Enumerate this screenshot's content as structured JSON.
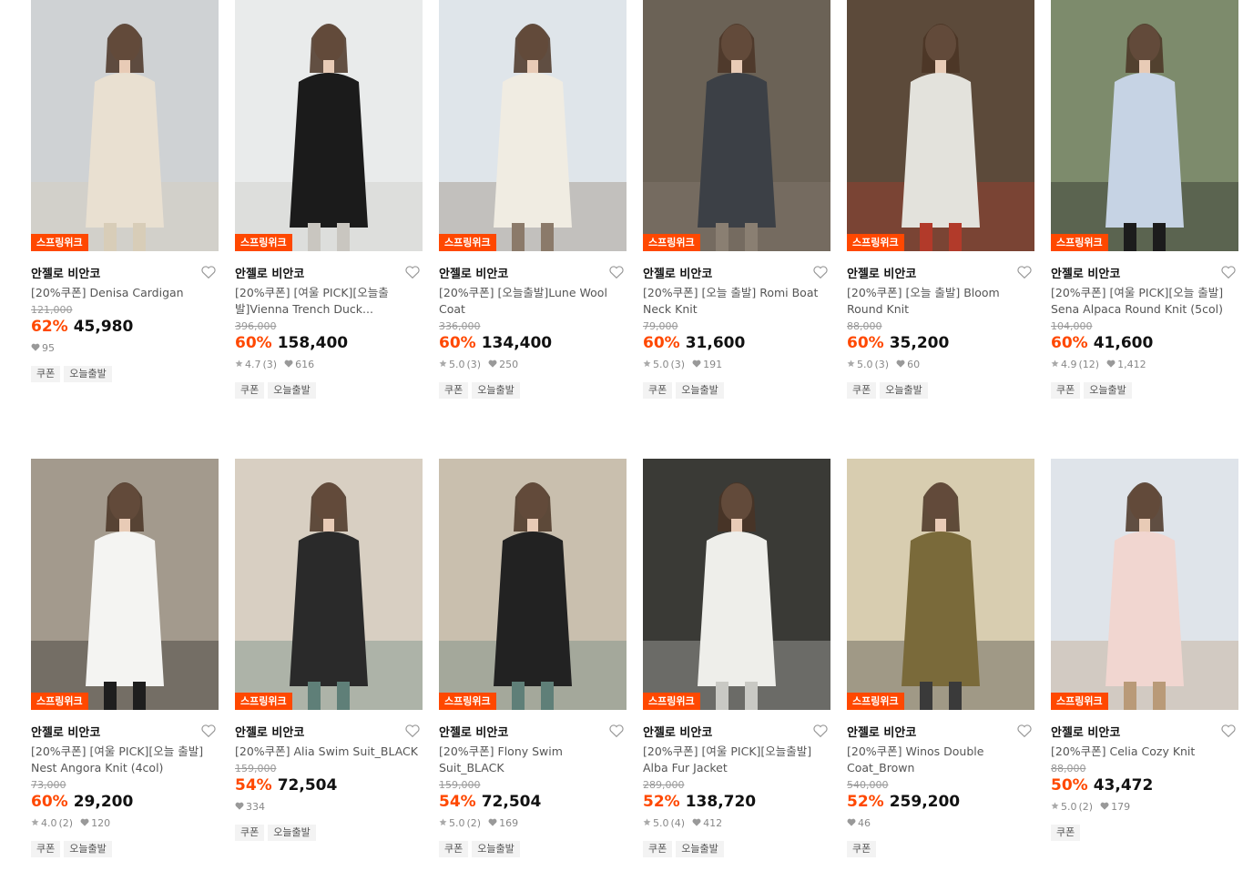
{
  "badge_label": "스프링위크",
  "products": [
    {
      "brand": "안젤로 비안코",
      "name": "[20%쿠폰] Denisa Cardigan",
      "original_price": "121,000",
      "discount": "62%",
      "price": "45,980",
      "rating": "",
      "reviews": "",
      "likes": "95",
      "tags": [
        "쿠폰",
        "오늘출발"
      ],
      "palette": {
        "bg": "#cfd2d4",
        "main": "#e9e0d1",
        "accent": "#d8cdb8"
      }
    },
    {
      "brand": "안젤로 비안코",
      "name": "[20%쿠폰] [여울 PICK][오늘출발]Vienna Trench Duck...",
      "original_price": "396,000",
      "discount": "60%",
      "price": "158,400",
      "rating": "4.7",
      "reviews": "(3)",
      "likes": "616",
      "tags": [
        "쿠폰",
        "오늘출발"
      ],
      "palette": {
        "bg": "#e9ebeb",
        "main": "#1b1b1b",
        "accent": "#c9c6c0"
      }
    },
    {
      "brand": "안젤로 비안코",
      "name": "[20%쿠폰] [오늘출발]Lune Wool Coat",
      "original_price": "336,000",
      "discount": "60%",
      "price": "134,400",
      "rating": "5.0",
      "reviews": "(3)",
      "likes": "250",
      "tags": [
        "쿠폰",
        "오늘출발"
      ],
      "palette": {
        "bg": "#dfe5ea",
        "main": "#f0ece2",
        "accent": "#8b7a6a"
      }
    },
    {
      "brand": "안젤로 비안코",
      "name": "[20%쿠폰] [오늘 출발] Romi Boat Neck Knit",
      "original_price": "79,000",
      "discount": "60%",
      "price": "31,600",
      "rating": "5.0",
      "reviews": "(3)",
      "likes": "191",
      "tags": [
        "쿠폰",
        "오늘출발"
      ],
      "palette": {
        "bg": "#6b6256",
        "main": "#3c4046",
        "accent": "#8a7f72"
      }
    },
    {
      "brand": "안젤로 비안코",
      "name": "[20%쿠폰] [오늘 출발] Bloom Round Knit",
      "original_price": "88,000",
      "discount": "60%",
      "price": "35,200",
      "rating": "5.0",
      "reviews": "(3)",
      "likes": "60",
      "tags": [
        "쿠폰",
        "오늘출발"
      ],
      "palette": {
        "bg": "#5c4a3a",
        "main": "#e3e2dc",
        "accent": "#b23a2a"
      }
    },
    {
      "brand": "안젤로 비안코",
      "name": "[20%쿠폰] [여울 PICK][오늘 출발] Sena Alpaca Round Knit (5col)",
      "original_price": "104,000",
      "discount": "60%",
      "price": "41,600",
      "rating": "4.9",
      "reviews": "(12)",
      "likes": "1,412",
      "tags": [
        "쿠폰",
        "오늘출발"
      ],
      "palette": {
        "bg": "#7d8b6c",
        "main": "#c6d3e4",
        "accent": "#1c1c1c"
      }
    },
    {
      "brand": "안젤로 비안코",
      "name": "[20%쿠폰] [여울 PICK][오늘 출발] Nest Angora Knit (4col)",
      "original_price": "73,000",
      "discount": "60%",
      "price": "29,200",
      "rating": "4.0",
      "reviews": "(2)",
      "likes": "120",
      "tags": [
        "쿠폰",
        "오늘출발"
      ],
      "palette": {
        "bg": "#a39a8d",
        "main": "#f4f4f2",
        "accent": "#1e1e1e"
      }
    },
    {
      "brand": "안젤로 비안코",
      "name": "[20%쿠폰] Alia Swim Suit_BLACK",
      "original_price": "159,000",
      "discount": "54%",
      "price": "72,504",
      "rating": "",
      "reviews": "",
      "likes": "334",
      "tags": [
        "쿠폰",
        "오늘출발"
      ],
      "palette": {
        "bg": "#d8cfc2",
        "main": "#2a2a2a",
        "accent": "#5f7f78"
      }
    },
    {
      "brand": "안젤로 비안코",
      "name": "[20%쿠폰] Flony Swim Suit_BLACK",
      "original_price": "159,000",
      "discount": "54%",
      "price": "72,504",
      "rating": "5.0",
      "reviews": "(2)",
      "likes": "169",
      "tags": [
        "쿠폰",
        "오늘출발"
      ],
      "palette": {
        "bg": "#c9bfae",
        "main": "#222222",
        "accent": "#5f7f78"
      }
    },
    {
      "brand": "안젤로 비안코",
      "name": "[20%쿠폰] [여울 PICK][오늘출발] Alba Fur Jacket",
      "original_price": "289,000",
      "discount": "52%",
      "price": "138,720",
      "rating": "5.0",
      "reviews": "(4)",
      "likes": "412",
      "tags": [
        "쿠폰",
        "오늘출발"
      ],
      "palette": {
        "bg": "#3a3a36",
        "main": "#eeeeea",
        "accent": "#c9c9c4"
      }
    },
    {
      "brand": "안젤로 비안코",
      "name": "[20%쿠폰] Winos Double Coat_Brown",
      "original_price": "540,000",
      "discount": "52%",
      "price": "259,200",
      "rating": "",
      "reviews": "",
      "likes": "46",
      "tags": [
        "쿠폰"
      ],
      "palette": {
        "bg": "#d8cdb0",
        "main": "#7a6a3a",
        "accent": "#3a3a3a"
      }
    },
    {
      "brand": "안젤로 비안코",
      "name": "[20%쿠폰] Celia Cozy Knit",
      "original_price": "88,000",
      "discount": "50%",
      "price": "43,472",
      "rating": "5.0",
      "reviews": "(2)",
      "likes": "179",
      "tags": [
        "쿠폰"
      ],
      "palette": {
        "bg": "#dfe4ea",
        "main": "#f1d6d0",
        "accent": "#b99a78"
      }
    }
  ]
}
